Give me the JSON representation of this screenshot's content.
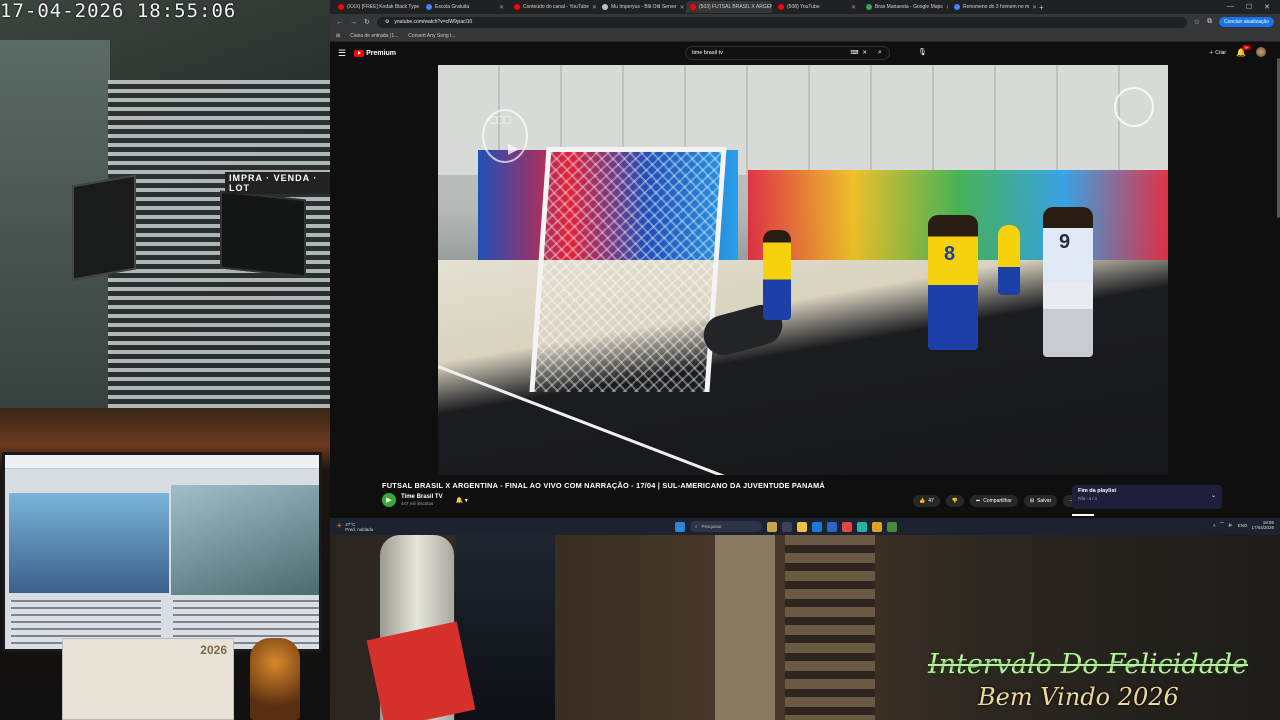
{
  "overlay": {
    "clock": "17-04-2026  18:55:06",
    "title": "Intervalo Do Felicidade",
    "subtitle": "Bem Vindo 2026",
    "calendar_year": "2026",
    "sign_text": "IMPRA · VENDA · LOT"
  },
  "browser": {
    "tabs": [
      {
        "label": "(XXX) [FREE] Kodak Black Type",
        "color": "#ff0000",
        "active": false
      },
      {
        "label": "Escola Gratuita",
        "color": "#4285f4",
        "active": false
      },
      {
        "label": "Conteúdo do canal - YouTube",
        "color": "#ff0000",
        "active": false
      },
      {
        "label": "Mu Imperyus - Blit Old Server",
        "color": "#c0c0c0",
        "active": false
      },
      {
        "label": "(503) FUTSAL BRASIL X ARGEN",
        "color": "#ff0000",
        "active": true
      },
      {
        "label": "(508) YouTube",
        "color": "#ff0000",
        "active": false
      },
      {
        "label": "Bras Mariaesta - Google Maps",
        "color": "#34a853",
        "active": false
      },
      {
        "label": "Renomeno do 3 homem no m",
        "color": "#4285f4",
        "active": false
      }
    ],
    "new_tab": "+",
    "url": "youtube.com/watch?v=clW9yiacl10",
    "finish_button": "Concluir atualização",
    "bookmarks": [
      "Caixa de entrada (1...",
      "Convert Any Song I..."
    ]
  },
  "youtube": {
    "logo": "Premium",
    "search_value": "time brasil tv",
    "create_label": "Criar",
    "notif_badge": "9+",
    "video_title": "FUTSAL BRASIL X ARGENTINA - FINAL AO VIVO COM NARRAÇÃO - 17/04 | SUL-AMERICANO DA JUVENTUDE PANAMÁ",
    "channel_name": "Time Brasil TV",
    "channel_subs": "447 mil inscritos",
    "likes": "47",
    "share_label": "Compartilhar",
    "save_label": "Salvar",
    "more_label": "···",
    "playlist_title": "Fim da playlist",
    "playlist_sub": "Fifa - 4 / 4",
    "jersey_8": "8",
    "jersey_9": "9"
  },
  "taskbar": {
    "weather_temp": "27°C",
    "weather_desc": "Pred. nublado",
    "search_placeholder": "Pesquisar",
    "lang": "ENG",
    "time": "18:55",
    "date": "17/04/2026"
  },
  "colors": {
    "yt_red": "#ff0000",
    "brazil_yellow": "#f5d20b",
    "brazil_blue": "#1d3fa8",
    "overlay_green": "#b8f0a0",
    "overlay_gold": "#eed89a"
  }
}
